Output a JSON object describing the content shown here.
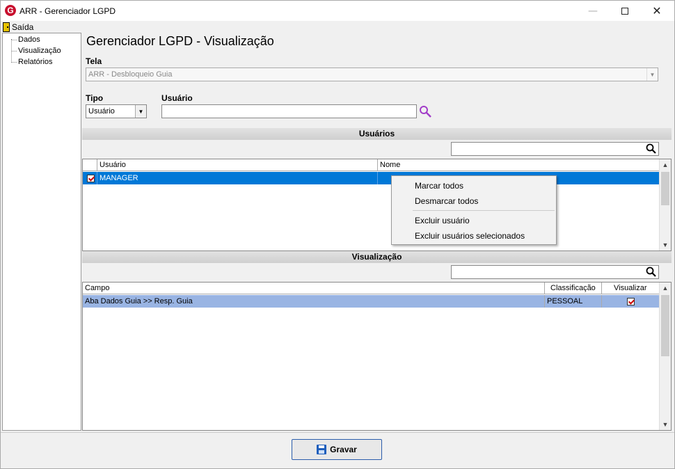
{
  "window": {
    "title": "ARR - Gerenciador LGPD",
    "app_icon_letter": "G"
  },
  "menu": {
    "items": [
      {
        "label": "Saída",
        "icon": "door-exit-icon"
      }
    ]
  },
  "sidebar": {
    "items": [
      {
        "label": "Dados"
      },
      {
        "label": "Visualização"
      },
      {
        "label": "Relatórios"
      }
    ]
  },
  "page": {
    "title": "Gerenciador LGPD - Visualização"
  },
  "form": {
    "tela_label": "Tela",
    "tela_value": "ARR - Desbloqueio Guia",
    "tipo_label": "Tipo",
    "tipo_value": "Usuário",
    "usuario_label": "Usuário",
    "usuario_value": ""
  },
  "users_section": {
    "title": "Usuários",
    "filter_value": "",
    "columns": [
      "Usuário",
      "Nome"
    ],
    "rows": [
      {
        "checked": true,
        "usuario": "MANAGER",
        "nome": ""
      }
    ]
  },
  "context_menu": {
    "items": [
      "Marcar todos",
      "Desmarcar todos",
      "Excluir usuário",
      "Excluir usuários selecionados"
    ]
  },
  "visualizacao_section": {
    "title": "Visualização",
    "filter_value": "",
    "columns": [
      "Campo",
      "Classificação",
      "Visualizar"
    ],
    "rows": [
      {
        "campo": "Aba Dados Guia >> Resp. Guia",
        "classificacao": "PESSOAL",
        "visualizar": true
      }
    ]
  },
  "footer": {
    "save_label": "Gravar"
  },
  "colors": {
    "selection_blue": "#0078d7",
    "row_highlight": "#99b4e3",
    "search_icon_purple": "#a23cc8"
  }
}
